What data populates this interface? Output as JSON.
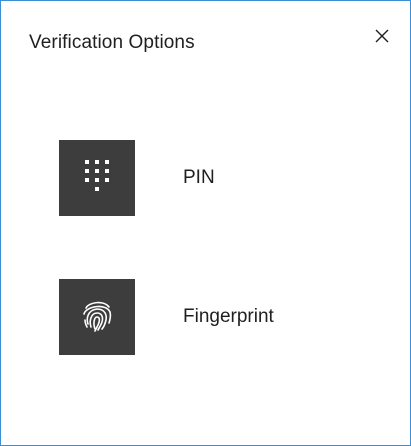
{
  "dialog": {
    "title": "Verification Options"
  },
  "options": [
    {
      "label": "PIN",
      "icon": "pin-keypad-icon"
    },
    {
      "label": "Fingerprint",
      "icon": "fingerprint-icon"
    }
  ],
  "colors": {
    "border": "#3b8fd6",
    "tile": "#3d3d3d",
    "text": "#1f1f1f"
  }
}
